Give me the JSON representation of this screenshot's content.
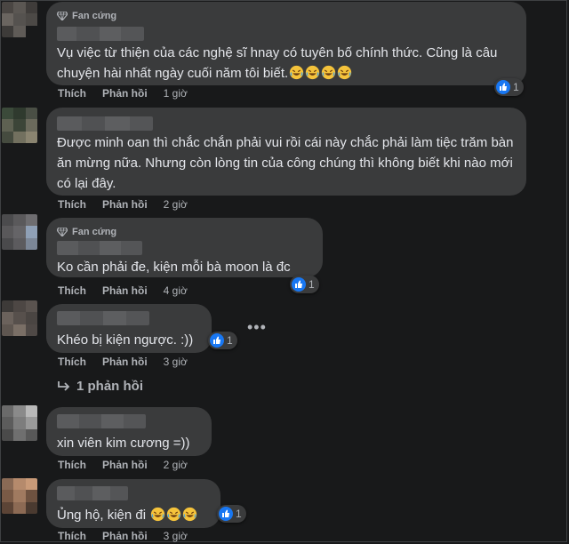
{
  "actions": {
    "like": "Thích",
    "reply": "Phản hồi"
  },
  "colors": {
    "like": "#1877f2",
    "bubble": "#3a3b3c",
    "background": "#18191a"
  },
  "comments": [
    {
      "badge": "Fan cứng",
      "text": "Vụ việc từ thiện của các nghệ sĩ hnay có tuyên bố chính thức. Cũng là câu chuyện hài nhất ngày cuối năm tôi biết.",
      "emoji_count": 4,
      "time": "1 giờ",
      "reactions": "1"
    },
    {
      "text": "Được minh oan thì chắc chắn phải vui rồi cái này chắc phải làm tiệc trăm bàn ăn mừng nữa. Nhưng còn lòng tin của công chúng thì không biết khi nào mới có lại đây.",
      "time": "2 giờ"
    },
    {
      "badge": "Fan cứng",
      "text": "Ko cần phải đe, kiện mỗi bà moon là đc",
      "time": "4 giờ",
      "reactions": "1"
    },
    {
      "text": "Khéo bị kiện ngược. :))",
      "time": "3 giờ",
      "reactions": "1",
      "replies": "1 phản hồi"
    },
    {
      "text": "xin viên kim cương =))",
      "time": "2 giờ"
    },
    {
      "text": "Ủng hộ, kiện đi",
      "emoji_count": 3,
      "time": "3 giờ",
      "reactions": "1"
    }
  ],
  "icons": {
    "badge": "diamond-icon",
    "like": "like-icon",
    "emoji": "rolling-on-floor-laughing-emoji",
    "reply": "reply-arrow-icon",
    "more": "more-options-icon"
  }
}
